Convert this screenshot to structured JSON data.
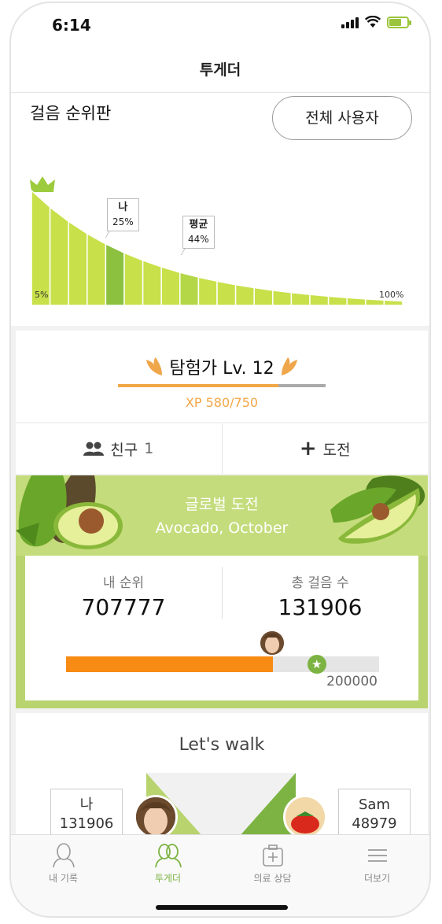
{
  "status_bar": {
    "time": "6:14"
  },
  "nav": {
    "title": "투게더"
  },
  "leaderboard": {
    "title": "걸음 순위판",
    "all_users_button": "전체 사용자",
    "me_label": "나",
    "me_percent": "25%",
    "avg_label": "평균",
    "avg_percent": "44%",
    "axis_start": "5%",
    "axis_end": "100%"
  },
  "level": {
    "title": "탐험가 Lv. 12",
    "xp_text": "XP 580/750",
    "xp_fraction": 0.773
  },
  "actions": {
    "friends_label": "친구",
    "friends_count": "1",
    "challenge_label": "도전"
  },
  "global_challenge": {
    "title": "글로벌 도전",
    "subtitle": "Avocado, October",
    "my_rank_label": "내 순위",
    "my_rank_value": "707777",
    "total_steps_label": "총 걸음 수",
    "total_steps_value": "131906",
    "goal_value": "200000",
    "progress_fraction": 0.66
  },
  "lets_walk": {
    "title": "Let's walk",
    "me_name": "나",
    "me_steps": "131906",
    "other_name": "Sam",
    "other_steps": "48979"
  },
  "tabbar": {
    "tabs": [
      {
        "label": "내 기록",
        "icon": "person-icon"
      },
      {
        "label": "투게더",
        "icon": "together-icon"
      },
      {
        "label": "의료 상담",
        "icon": "medical-kit-icon"
      },
      {
        "label": "더보기",
        "icon": "menu-icon"
      }
    ]
  },
  "colors": {
    "accent_green": "#7cb342",
    "chart_green": "#c8e04a",
    "orange": "#f78b13",
    "xp_orange": "#f2a746"
  }
}
